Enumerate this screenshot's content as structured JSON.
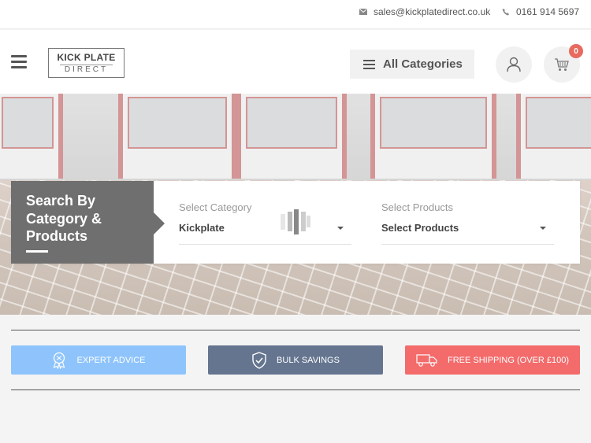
{
  "topbar": {
    "email": "sales@kickplatedirect.co.uk",
    "phone": "0161 914 5697"
  },
  "header": {
    "logo_line1": "KICK PLATE",
    "logo_line2": "DIRECT",
    "categories_label": "All Categories",
    "cart_count": "0"
  },
  "search": {
    "title_line1": "Search By",
    "title_line2": "Category &",
    "title_line3": "Products",
    "category_label": "Select Category",
    "category_value": "Kickplate",
    "products_label": "Select Products",
    "products_value": "Select Products"
  },
  "usps": [
    {
      "label": "EXPERT ADVICE",
      "icon": "award-icon",
      "color": "#8ec4fb"
    },
    {
      "label": "BULK SAVINGS",
      "icon": "shield-check-icon",
      "color": "#657590"
    },
    {
      "label": "FREE SHIPPING (OVER £100)",
      "icon": "truck-icon",
      "color": "#f36b6b"
    }
  ],
  "colors": {
    "accent_red": "#e86a5f",
    "search_title_bg": "#6f6f6f"
  }
}
